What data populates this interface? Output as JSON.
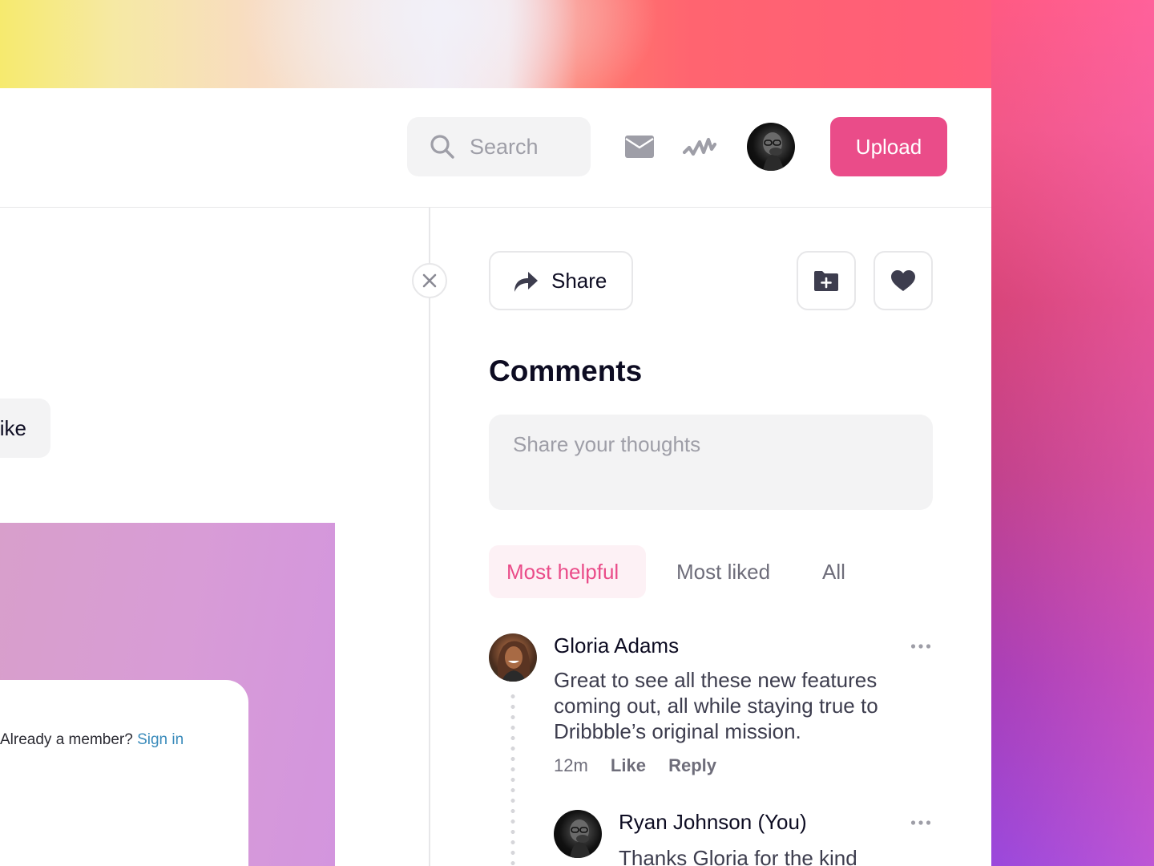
{
  "header": {
    "search_placeholder": "Search",
    "upload_label": "Upload",
    "icons": [
      "search-icon",
      "mail-icon",
      "activity-icon",
      "user-avatar"
    ]
  },
  "left": {
    "like_label": "Like",
    "like_label_visible": "ike",
    "member_prompt": "Already a member?",
    "sign_in_label": "Sign in"
  },
  "panel": {
    "share_label": "Share",
    "collect_icon": "folder-plus-icon",
    "like_icon": "heart-icon",
    "comments_title": "Comments",
    "comment_placeholder": "Share your thoughts",
    "tabs": [
      {
        "label": "Most helpful",
        "active": true
      },
      {
        "label": "Most liked",
        "active": false
      },
      {
        "label": "All",
        "active": false
      }
    ],
    "comments": [
      {
        "author": "Gloria Adams",
        "text": "Great to see all these new features coming out, all while staying true to Dribbble’s original mission.",
        "time": "12m",
        "like_label": "Like",
        "reply_label": "Reply"
      },
      {
        "author": "Ryan Johnson (You)",
        "text": "Thanks Gloria for the kind"
      }
    ]
  },
  "colors": {
    "accent": "#ea4c89",
    "accent_soft": "#fdf1f5",
    "text_primary": "#0d0c22",
    "text_secondary": "#6e6d7a",
    "link": "#3a8bbb"
  }
}
